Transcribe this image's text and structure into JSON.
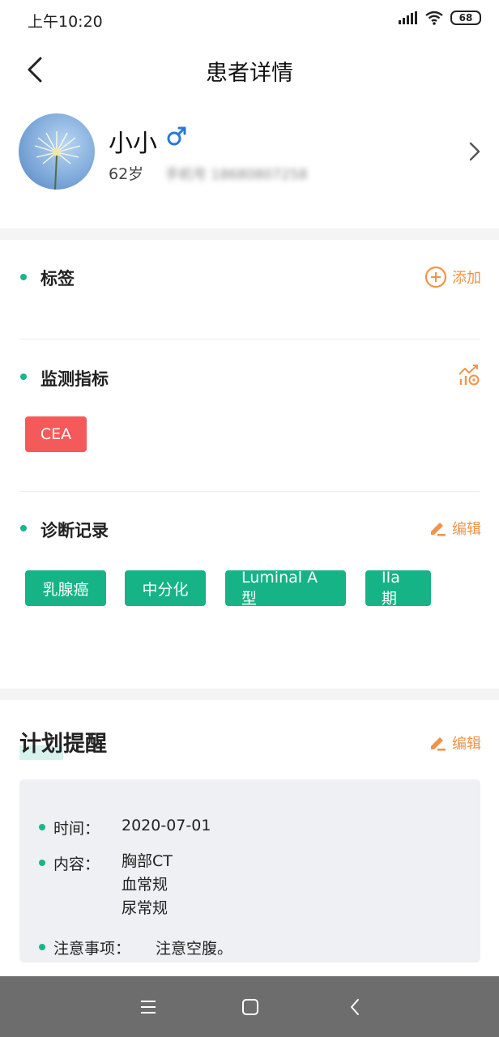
{
  "status_bar": {
    "time": "上午10:20",
    "battery": "68"
  },
  "header": {
    "title": "患者详情"
  },
  "patient": {
    "name": "小小",
    "age": "62岁",
    "phone": "手机号 18680807258"
  },
  "tags_section": {
    "title": "标签",
    "action_label": "添加"
  },
  "monitor_section": {
    "title": "监测指标",
    "chips": [
      "CEA"
    ]
  },
  "diagnosis_section": {
    "title": "诊断记录",
    "action_label": "编辑",
    "chips": [
      "乳腺癌",
      "中分化",
      "Luminal A型",
      "IIa期"
    ]
  },
  "plan_section": {
    "title": "计划提醒",
    "action_label": "编辑",
    "time_label": "时间：",
    "time_value": "2020-07-01",
    "content_label": "内容：",
    "content_items": [
      "胸部CT",
      "血常规",
      "尿常规"
    ],
    "note_label": "注意事项：",
    "note_value": "注意空腹。"
  },
  "colors": {
    "accent_green": "#16b386",
    "accent_orange": "#f0944a",
    "chip_red": "#f45a5a",
    "gender_blue": "#2a78d6"
  },
  "icons": [
    "back-icon",
    "male-icon",
    "chevron-right-icon",
    "add-circle-icon",
    "chart-settings-icon",
    "edit-icon",
    "menu-icon",
    "home-icon",
    "back-nav-icon"
  ]
}
